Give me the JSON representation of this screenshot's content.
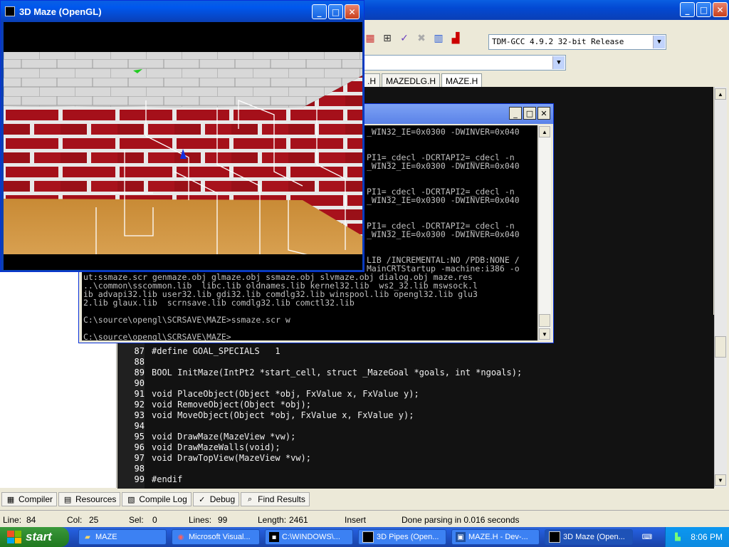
{
  "ide": {
    "window_buttons": [
      "_",
      "□",
      "✕"
    ],
    "compiler_combo": "TDM-GCC 4.9.2 32-bit Release",
    "tabs": [
      ".H",
      "MAZEDLG.H",
      "MAZE.H"
    ],
    "bottom_tabs": [
      {
        "label": "Compiler",
        "icon": "compiler-icon"
      },
      {
        "label": "Resources",
        "icon": "resources-icon"
      },
      {
        "label": "Compile Log",
        "icon": "compile-log-icon"
      },
      {
        "label": "Debug",
        "icon": "debug-icon"
      },
      {
        "label": "Find Results",
        "icon": "find-results-icon"
      }
    ],
    "code_lines": [
      {
        "num": "87",
        "text": "#define GOAL_SPECIALS   1"
      },
      {
        "num": "88",
        "text": ""
      },
      {
        "num": "89",
        "text": "BOOL InitMaze(IntPt2 *start_cell, struct _MazeGoal *goals, int *ngoals);"
      },
      {
        "num": "90",
        "text": ""
      },
      {
        "num": "91",
        "text": "void PlaceObject(Object *obj, FxValue x, FxValue y);"
      },
      {
        "num": "92",
        "text": "void RemoveObject(Object *obj);"
      },
      {
        "num": "93",
        "text": "void MoveObject(Object *obj, FxValue x, FxValue y);"
      },
      {
        "num": "94",
        "text": ""
      },
      {
        "num": "95",
        "text": "void DrawMaze(MazeView *vw);"
      },
      {
        "num": "96",
        "text": "void DrawMazeWalls(void);"
      },
      {
        "num": "97",
        "text": "void DrawTopView(MazeView *vw);"
      },
      {
        "num": "98",
        "text": ""
      },
      {
        "num": "99",
        "text": "#endif"
      }
    ],
    "status": {
      "line_label": "Line:",
      "line_value": "84",
      "col_label": "Col:",
      "col_value": "25",
      "sel_label": "Sel:",
      "sel_value": "0",
      "lines_label": "Lines:",
      "lines_value": "99",
      "length_label": "Length:",
      "length_value": "2461",
      "mode": "Insert",
      "message": "Done parsing in 0.016 seconds"
    }
  },
  "console": {
    "window_buttons": [
      "_",
      "□",
      "✕"
    ],
    "lines": [
      "_WIN32_IE=0x0300 -DWINVER=0x040",
      "",
      "",
      "PI1=_cdecl -DCRTAPI2=_cdecl -n",
      "_WIN32_IE=0x0300 -DWINVER=0x040",
      "",
      "",
      "PI1=_cdecl -DCRTAPI2=_cdecl -n",
      "_WIN32_IE=0x0300 -DWINVER=0x040",
      "",
      "",
      "PI1=_cdecl -DCRTAPI2=_cdecl -n",
      "_WIN32_IE=0x0300 -DWINVER=0x040",
      "",
      "",
      "LIB /INCREMENTAL:NO /PDB:NONE /",
      "MainCRTStartup -machine:i386 -o",
      "ut:ssmaze.scr genmaze.obj glmaze.obj ssmaze.obj slvmaze.obj dialog.obj maze.res",
      "..\\common\\sscommon.lib  libc.lib oldnames.lib kernel32.lib  ws2_32.lib mswsock.l",
      "ib advapi32.lib user32.lib gdi32.lib comdlg32.lib winspool.lib opengl32.lib glu3",
      "2.lib glaux.lib  scrnsave.lib comdlg32.lib comctl32.lib",
      "",
      "C:\\source\\opengl\\SCRSAVE\\MAZE>ssmaze.scr w",
      "",
      "C:\\source\\opengl\\SCRSAVE\\MAZE>"
    ]
  },
  "maze_window": {
    "title": "3D Maze (OpenGL)",
    "window_buttons": [
      "_",
      "□",
      "✕"
    ]
  },
  "taskbar": {
    "start_label": "start",
    "items": [
      {
        "label": "MAZE",
        "icon": "folder-icon"
      },
      {
        "label": "Microsoft Visual...",
        "icon": "visual-studio-icon"
      },
      {
        "label": "C:\\WINDOWS\\...",
        "icon": "console-icon"
      },
      {
        "label": "3D Pipes (Open...",
        "icon": "opengl-icon"
      },
      {
        "label": "MAZE.H - Dev-...",
        "icon": "dev-cpp-icon"
      },
      {
        "label": "3D Maze (Open...",
        "icon": "opengl-icon"
      }
    ],
    "clock": "8:06 PM"
  }
}
